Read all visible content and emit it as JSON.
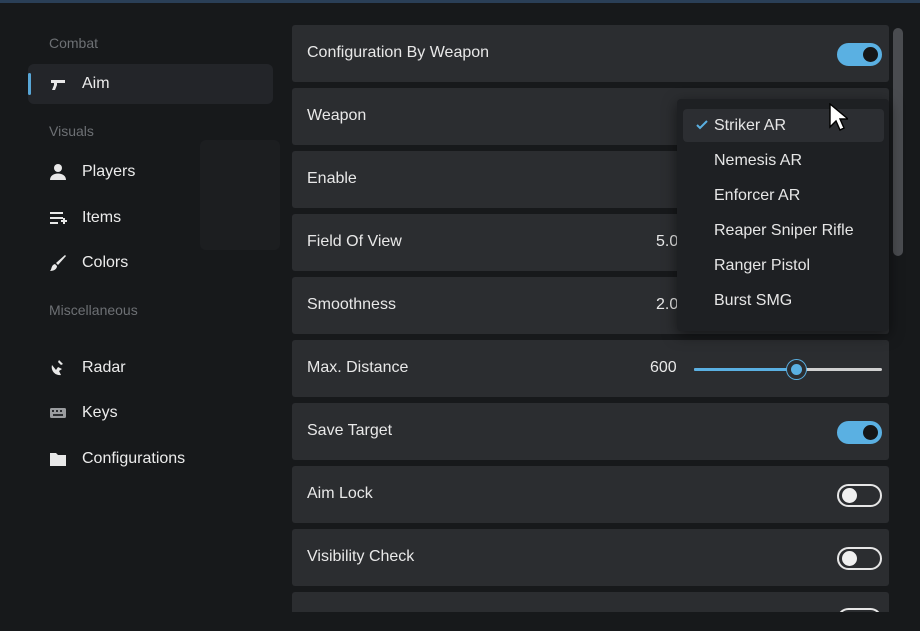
{
  "sidebar": {
    "sections": [
      "Combat",
      "Visuals",
      "Miscellaneous"
    ],
    "items": [
      {
        "label": "Aim",
        "icon": "pistol-icon",
        "active": true
      },
      {
        "label": "Players",
        "icon": "user-icon"
      },
      {
        "label": "Items",
        "icon": "list-add-icon"
      },
      {
        "label": "Colors",
        "icon": "brush-icon"
      },
      {
        "label": "Radar",
        "icon": "radar-icon"
      },
      {
        "label": "Keys",
        "icon": "keyboard-icon"
      },
      {
        "label": "Configurations",
        "icon": "folder-icon"
      }
    ]
  },
  "settings": {
    "config_by_weapon": {
      "label": "Configuration By Weapon",
      "on": true
    },
    "weapon": {
      "label": "Weapon",
      "value": "Striker AR"
    },
    "enable": {
      "label": "Enable"
    },
    "fov": {
      "label": "Field Of View",
      "value_partial": "5.0"
    },
    "smoothness": {
      "label": "Smoothness",
      "value_partial": "2.0"
    },
    "max_distance": {
      "label": "Max. Distance",
      "value": "600",
      "fraction": 0.54
    },
    "save_target": {
      "label": "Save Target",
      "on": true
    },
    "aim_lock": {
      "label": "Aim Lock",
      "on": false
    },
    "visibility_check": {
      "label": "Visibility Check",
      "on": false
    }
  },
  "weapon_dropdown": {
    "selected": "Striker AR",
    "options": [
      "Striker AR",
      "Nemesis AR",
      "Enforcer AR",
      "Reaper Sniper Rifle",
      "Ranger Pistol",
      "Burst SMG"
    ]
  },
  "colors": {
    "accent": "#5ab0e2",
    "background": "#17191b",
    "row": "#2b2d30",
    "dropdown": "#1e2023"
  }
}
